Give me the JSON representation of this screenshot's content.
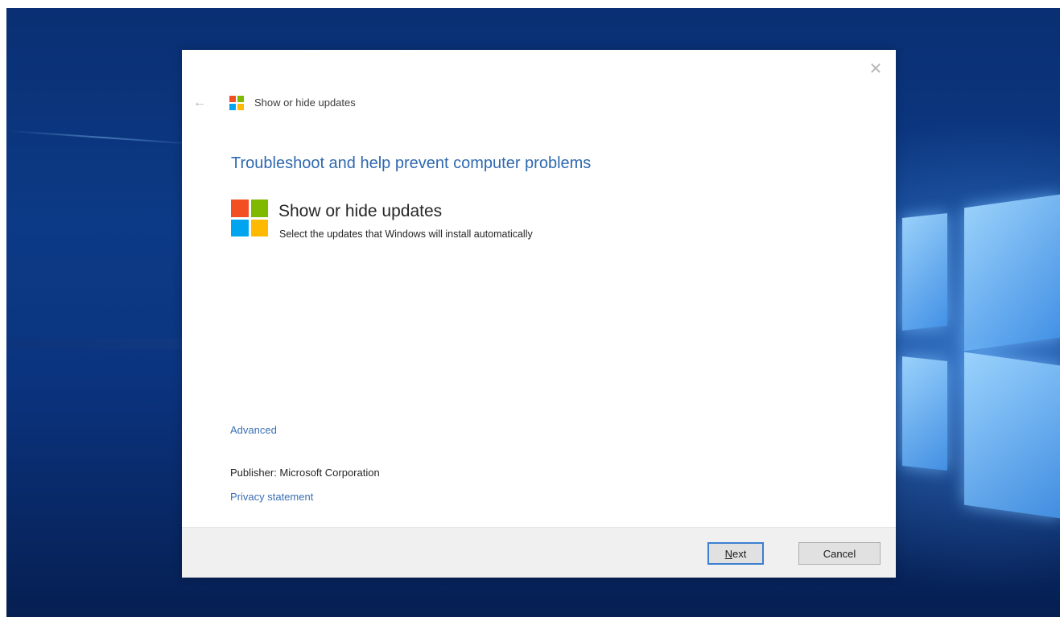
{
  "window": {
    "title": "Show or hide updates",
    "close_glyph": "✕",
    "back_glyph": "←"
  },
  "main": {
    "heading": "Troubleshoot and help prevent computer problems",
    "tool_name": "Show or hide updates",
    "tool_description": "Select the updates that Windows will install automatically"
  },
  "links": {
    "advanced": "Advanced",
    "privacy": "Privacy statement"
  },
  "publisher": {
    "text": "Publisher:  Microsoft Corporation"
  },
  "footer": {
    "next_mnemonic": "N",
    "next_rest": "ext",
    "cancel_label": "Cancel"
  },
  "icons": {
    "logo": "windows-logo-icon",
    "back": "back-arrow-icon",
    "close": "close-icon"
  },
  "colors": {
    "heading": "#2f69b0",
    "link": "#3a6fb5",
    "logo_red": "#f25022",
    "logo_green": "#7fba00",
    "logo_blue": "#00a4ef",
    "logo_yellow": "#ffb900",
    "desktop": "#0b3480"
  }
}
